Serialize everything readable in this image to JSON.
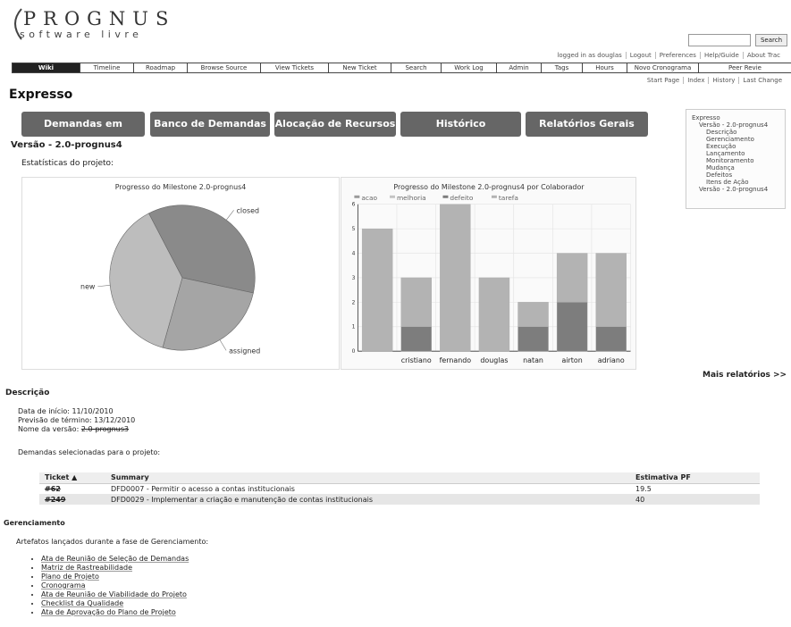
{
  "logo": {
    "main": "PROGNUS",
    "sub": "software livre"
  },
  "search": {
    "placeholder": "",
    "button_label": "Search"
  },
  "metanav": [
    "logged in as douglas",
    "Logout",
    "Preferences",
    "Help/Guide",
    "About Trac"
  ],
  "mainnav": [
    {
      "label": "Wiki",
      "active": true
    },
    {
      "label": "Timeline"
    },
    {
      "label": "Roadmap"
    },
    {
      "label": "Browse Source"
    },
    {
      "label": "View Tickets"
    },
    {
      "label": "New Ticket"
    },
    {
      "label": "Search"
    },
    {
      "label": "Work Log"
    },
    {
      "label": "Admin"
    },
    {
      "label": "Tags"
    },
    {
      "label": "Hours"
    },
    {
      "label": "Novo Cronograma"
    },
    {
      "label": "Peer Revie"
    }
  ],
  "ctxnav": [
    "Start Page",
    "Index",
    "History",
    "Last Change"
  ],
  "page_title": "Expresso",
  "buttons": [
    "Demandas em Aquisição",
    "Banco de Demandas",
    "Alocação de Recursos",
    "Histórico",
    "Relatórios Gerais"
  ],
  "version_heading": "Versão - 2.0-prognus4",
  "stats_label": "Estatísticas do projeto:",
  "toc": [
    {
      "label": "Expresso",
      "level": 0
    },
    {
      "label": "Versão - 2.0-prognus4",
      "level": 1
    },
    {
      "label": "Descrição",
      "level": 2
    },
    {
      "label": "Gerenciamento",
      "level": 2
    },
    {
      "label": "Execução",
      "level": 2
    },
    {
      "label": "Lançamento",
      "level": 2
    },
    {
      "label": "Monitoramento",
      "level": 2
    },
    {
      "label": "Mudança",
      "level": 2
    },
    {
      "label": "Defeitos",
      "level": 2
    },
    {
      "label": "Itens de Ação",
      "level": 2
    },
    {
      "label": "Versão - 2.0-prognus4",
      "level": 1
    }
  ],
  "chart_data": [
    {
      "type": "pie",
      "title": "Progresso do Milestone 2.0-prognus4",
      "slices": [
        {
          "label": "closed",
          "value": 36,
          "color": "#8a8a8a"
        },
        {
          "label": "assigned",
          "value": 26,
          "color": "#a5a5a5"
        },
        {
          "label": "new",
          "value": 38,
          "color": "#bdbdbd"
        }
      ]
    },
    {
      "type": "bar",
      "title": "Progresso do Milestone 2.0-prognus4 por Colaborador",
      "legend": [
        "acao",
        "melhoria",
        "defeito",
        "tarefa"
      ],
      "categories": [
        "",
        "cristiano",
        "fernando",
        "douglas",
        "natan",
        "airton",
        "adriano"
      ],
      "ylim": [
        0,
        6
      ],
      "yticks": [
        0,
        1,
        2,
        3,
        4,
        5,
        6
      ],
      "series": [
        {
          "name": "defeito",
          "values": [
            0,
            1,
            0,
            0,
            1,
            2,
            1
          ],
          "color": "#7d7d7d"
        },
        {
          "name": "tarefa",
          "values": [
            5,
            2,
            6,
            3,
            1,
            2,
            3
          ],
          "color": "#b3b3b3"
        }
      ]
    }
  ],
  "more_reports": "Mais relatórios >>",
  "description": {
    "heading": "Descrição",
    "start": "Data de início: 11/10/2010",
    "end": "Previsão de término: 13/12/2010",
    "version_name_label": "Nome da versão: ",
    "version_name_value": "2.0-prognus3",
    "demands_label": "Demandas selecionadas para o projeto:"
  },
  "table": {
    "headers": [
      "Ticket ▲",
      "Summary",
      "Estimativa PF"
    ],
    "rows": [
      [
        "#62",
        "DFD0007 - Permitir o acesso a contas institucionais",
        "19.5"
      ],
      [
        "#249",
        "DFD0029 - Implementar a criação e manutenção de contas institucionais",
        "40"
      ]
    ]
  },
  "management": {
    "heading": "Gerenciamento",
    "label": "Artefatos lançados durante a fase de Gerenciamento:",
    "items": [
      "Ata de Reunião de Seleção de Demandas",
      "Matriz de Rastreabilidade",
      "Plano de Projeto",
      "Cronograma",
      "Ata de Reunião de Viabilidade do Projeto",
      "Checklist da Qualidade",
      "Ata de Aprovação do Plano de Projeto"
    ]
  }
}
